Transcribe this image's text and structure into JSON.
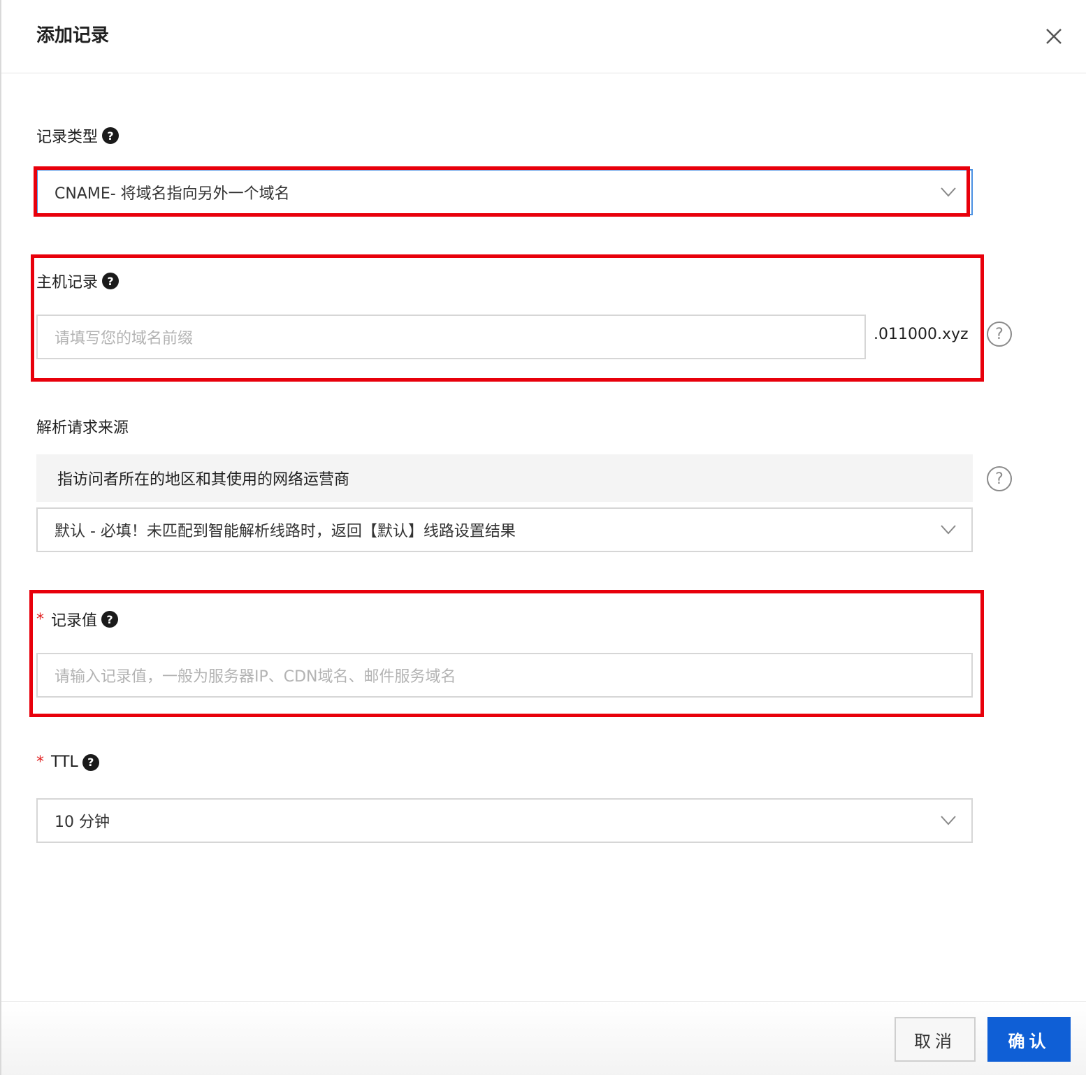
{
  "dialog": {
    "title": "添加记录",
    "close_icon": "close-icon"
  },
  "record_type": {
    "label": "记录类型",
    "help": "?",
    "value": "CNAME- 将域名指向另外一个域名"
  },
  "host_record": {
    "label": "主机记录",
    "help": "?",
    "placeholder": "请填写您的域名前缀",
    "suffix": ".011000.xyz",
    "help_ring": "?"
  },
  "resolve_source": {
    "label": "解析请求来源",
    "tip": "指访问者所在的地区和其使用的网络运营商",
    "help_ring": "?",
    "value": "默认 - 必填！未匹配到智能解析线路时，返回【默认】线路设置结果"
  },
  "record_value": {
    "required_mark": "*",
    "label": "记录值",
    "help": "?",
    "placeholder": "请输入记录值，一般为服务器IP、CDN域名、邮件服务域名"
  },
  "ttl": {
    "required_mark": "*",
    "label": "TTL",
    "help": "?",
    "value": "10 分钟"
  },
  "footer": {
    "cancel_label": "取消",
    "confirm_label": "确认"
  },
  "colors": {
    "highlight": "#e8000b",
    "primary": "#0f5fd6",
    "required": "#e02020"
  }
}
